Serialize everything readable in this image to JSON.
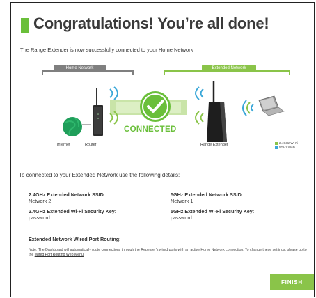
{
  "header": {
    "title": "Congratulations! You’re all done!",
    "subtitle": "The Range Extender is now successfully connected to your Home Network"
  },
  "diagram": {
    "home_network_label": "Home Network",
    "extended_network_label": "Extended Network",
    "connected_label": "CONNECTED",
    "internet_label": "Internet",
    "router_label": "Router",
    "range_extender_label": "Range Extender",
    "legend": [
      {
        "label": "2.4GHz Wi-Fi",
        "color": "#8ac449"
      },
      {
        "label": "5GHz Wi-Fi",
        "color": "#3aa7d8"
      }
    ],
    "colors": {
      "accent_green": "#6abf3a",
      "wifi_blue": "#3aa7d8",
      "gray": "#7f7f7f"
    }
  },
  "details": {
    "heading": "To connected to your Extended Network use the following details:",
    "ssid_24_label": "2.4GHz Extended Network SSID:",
    "ssid_24_value": "Network 2",
    "key_24_label": "2.4GHz Extended Wi-Fi Security Key:",
    "key_24_value": "password",
    "ssid_5_label": "5GHz Extended Network SSID:",
    "ssid_5_value": "Network 1",
    "key_5_label": "5GHz Extended Wi-Fi Security Key:",
    "key_5_value": "password"
  },
  "routing": {
    "heading": "Extended Network Wired Port Routing:",
    "note_text": "Note: The Dashboard will automatically route connections through the Repeater's wired ports with an active Home Network connection. To change these settings, please go to the",
    "link_text": "Wired Port Routing Web Menu",
    "note_end": "."
  },
  "actions": {
    "finish_label": "FINISH"
  }
}
